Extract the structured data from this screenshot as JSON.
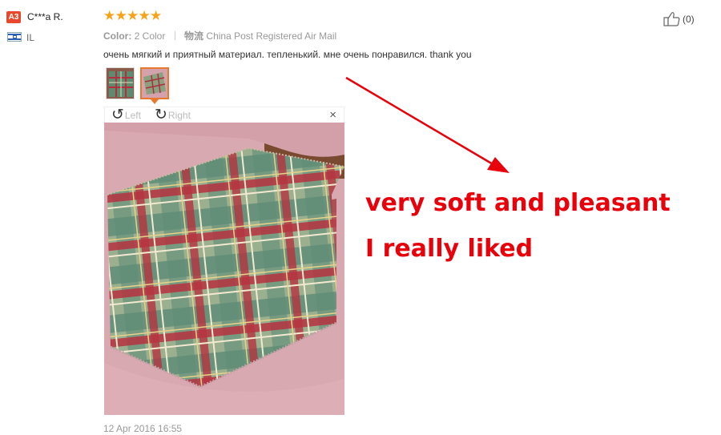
{
  "reviewer": {
    "badge": "A3",
    "name": "C***a R.",
    "country": "IL",
    "flag_icon": "israel-flag-icon"
  },
  "rating": {
    "stars": 5,
    "max": 5,
    "star_glyph": "★",
    "color": "#f7a21b"
  },
  "meta": {
    "color_label": "Color:",
    "color_value": "2 Color",
    "shipping_label": "物流",
    "shipping_value": "China Post Registered Air Mail"
  },
  "review_text": "очень мягкий и приятный материал. тепленький. мне очень понравился. thank you",
  "viewer": {
    "rotate_left_label": "Left",
    "rotate_right_label": "Right",
    "rotate_left_glyph": "↺",
    "rotate_right_glyph": "↻",
    "close_glyph": "×"
  },
  "date": "12 Apr 2016 16:55",
  "helpful": {
    "count_label": "(0)"
  },
  "annotation": {
    "line1": "very soft and pleasant",
    "line2": "I really liked",
    "color": "#e8000b"
  }
}
